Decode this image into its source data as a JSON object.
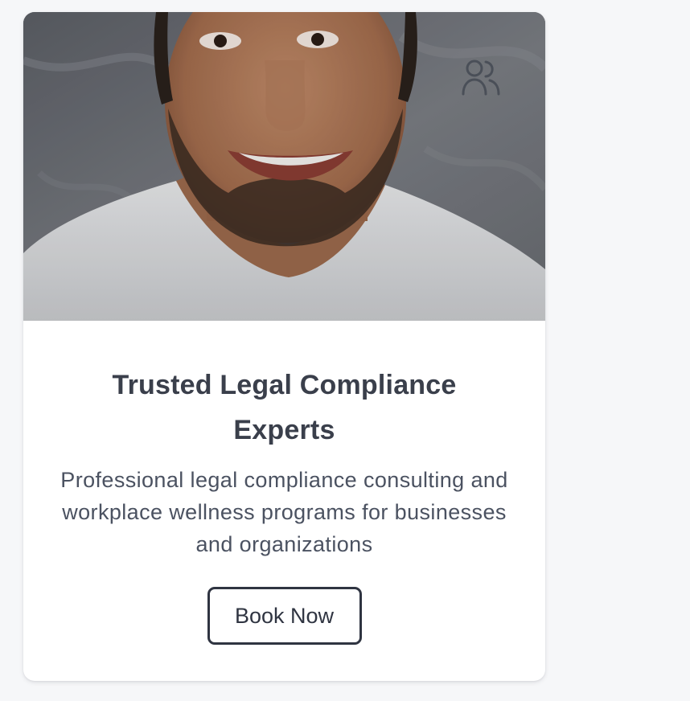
{
  "card": {
    "image_alt": "Smiling man in white shirt",
    "icon": "users-icon",
    "title": "Trusted Legal Compliance Experts",
    "description": "Professional legal compliance consulting and workplace wellness programs for businesses and organizations",
    "cta_label": "Book Now"
  },
  "colors": {
    "page_background": "#f6f7f9",
    "card_background": "#ffffff",
    "title_text": "#3a3f4b",
    "body_text": "#4b5261",
    "button_border": "#2f3441",
    "icon_stroke": "#4a4f58"
  }
}
